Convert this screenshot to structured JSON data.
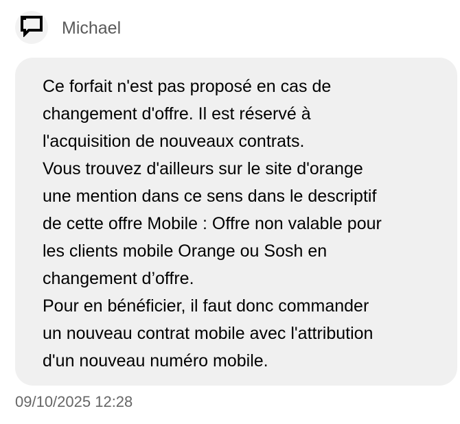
{
  "message": {
    "author": "Michael",
    "avatar_icon": "chat-bubble-icon",
    "text": "Ce forfait n'est pas proposé en cas de\nchangement d'offre. Il est réservé à\nl'acquisition de nouveaux contrats.\nVous trouvez d'ailleurs sur le site d'orange\nune mention dans ce sens dans le descriptif\nde cette offre Mobile : Offre non valable pour\nles clients mobile Orange ou Sosh en\nchangement d’offre.\nPour en bénéficier, il faut donc commander\nun nouveau contrat mobile avec l'attribution\nd'un nouveau numéro mobile.",
    "timestamp": "09/10/2025 12:28"
  },
  "colors": {
    "bubble_background": "#f0f0f0",
    "avatar_background": "#f2f2f2",
    "author_text": "#595959",
    "timestamp_text": "#666666"
  }
}
